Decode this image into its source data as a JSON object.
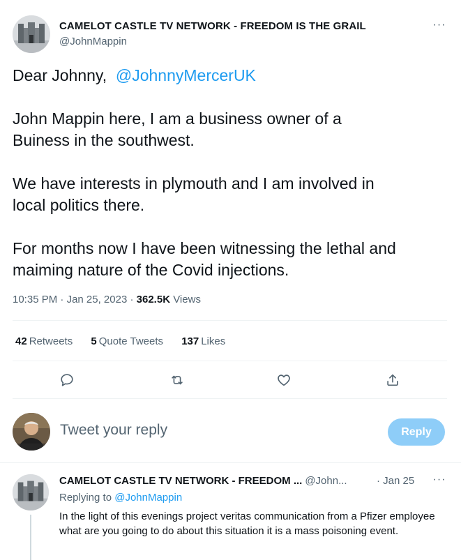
{
  "tweet": {
    "author_name": "CAMELOT CASTLE TV NETWORK - FREEDOM IS THE GRAIL",
    "author_handle": "@JohnMappin",
    "greeting": "Dear Johnny,",
    "mention": "@JohnnyMercerUK",
    "paragraphs": [
      [
        "John Mappin here, I am a business owner of a",
        "Buiness in the southwest."
      ],
      [
        "We have interests in plymouth and I am involved in",
        "local politics there."
      ],
      [
        "For months now I have been witnessing the lethal and",
        "maiming nature of the Covid injections."
      ]
    ],
    "time": "10:35 PM",
    "date": "Jan 25, 2023",
    "views_count": "362.5K",
    "views_label": "Views",
    "more_glyph": "···"
  },
  "stats": {
    "retweets_count": "42",
    "retweets_label": "Retweets",
    "quotes_count": "5",
    "quotes_label": "Quote Tweets",
    "likes_count": "137",
    "likes_label": "Likes"
  },
  "actions": [
    "comment-icon",
    "retweet-icon",
    "like-icon",
    "share-icon"
  ],
  "reply_box": {
    "placeholder": "Tweet your reply",
    "button_label": "Reply",
    "button_color": "#8ecdf8"
  },
  "reply_tweet": {
    "author_name": "CAMELOT CASTLE TV NETWORK - FREEDOM ...",
    "author_handle": "@John...",
    "date": "· Jan 25",
    "replying_label": "Replying to",
    "replying_handle": "@JohnMappin",
    "text": "In the light of this evenings project veritas communication from a Pfizer employee what are you going to do about this situation it is a mass poisoning event.",
    "more_glyph": "···"
  },
  "colors": {
    "accent": "#1d9bf0",
    "text_primary": "#0f1419",
    "text_secondary": "#536471",
    "divider": "#eff3f4"
  }
}
